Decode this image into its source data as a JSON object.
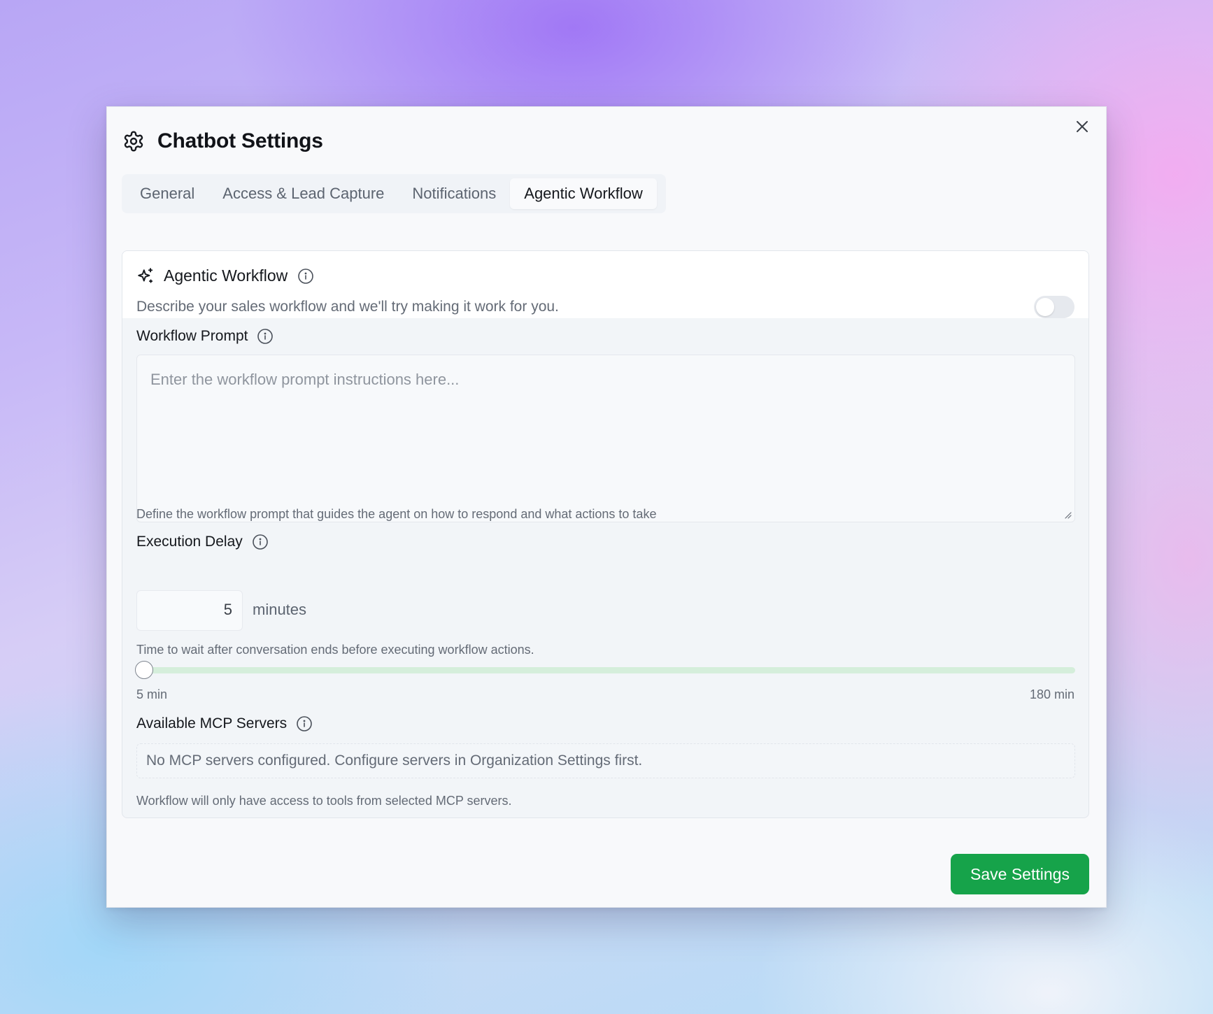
{
  "dialog": {
    "title": "Chatbot Settings",
    "icon": "gear-icon",
    "close_icon": "close-icon"
  },
  "tabs": [
    {
      "label": "General",
      "active": false
    },
    {
      "label": "Access & Lead Capture",
      "active": false
    },
    {
      "label": "Notifications",
      "active": false
    },
    {
      "label": "Agentic Workflow",
      "active": true
    }
  ],
  "card": {
    "title": "Agentic Workflow",
    "icon": "sparkle-icon",
    "description": "Describe your sales workflow and we'll try making it work for you.",
    "enabled": false
  },
  "workflow_prompt": {
    "label": "Workflow Prompt",
    "value": "",
    "placeholder": "Enter the workflow prompt instructions here...",
    "help": "Define the workflow prompt that guides the agent on how to respond and what actions to take"
  },
  "execution_delay": {
    "label": "Execution Delay",
    "value": "5",
    "unit": "minutes",
    "help": "Time to wait after conversation ends before executing workflow actions.",
    "slider_value": 5,
    "slider_min": 5,
    "slider_max": 180,
    "min_label": "5 min",
    "max_label": "180 min"
  },
  "mcp_servers": {
    "label": "Available MCP Servers",
    "empty_message": "No MCP servers configured. Configure servers in Organization Settings first.",
    "help": "Workflow will only have access to tools from selected MCP servers."
  },
  "footer": {
    "save_label": "Save Settings"
  },
  "colors": {
    "primary": "#16a34a",
    "slider_track": "#d5eedb"
  }
}
